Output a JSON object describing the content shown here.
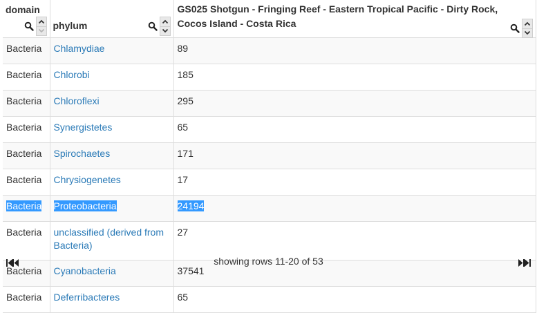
{
  "table": {
    "columns": [
      {
        "label": "domain"
      },
      {
        "label": "phylum"
      },
      {
        "label": "GS025 Shotgun - Fringing Reef - Eastern Tropical Pacific - Dirty Rock, Cocos Island - Costa Rica"
      }
    ],
    "rows": [
      {
        "domain": "Bacteria",
        "phylum": "Chlamydiae",
        "count": "89"
      },
      {
        "domain": "Bacteria",
        "phylum": "Chlorobi",
        "count": "185"
      },
      {
        "domain": "Bacteria",
        "phylum": "Chloroflexi",
        "count": "295"
      },
      {
        "domain": "Bacteria",
        "phylum": "Synergistetes",
        "count": "65"
      },
      {
        "domain": "Bacteria",
        "phylum": "Spirochaetes",
        "count": "171"
      },
      {
        "domain": "Bacteria",
        "phylum": "Chrysiogenetes",
        "count": "17"
      },
      {
        "domain": "Bacteria",
        "phylum": "Proteobacteria",
        "count": "24194"
      },
      {
        "domain": "Bacteria",
        "phylum": "unclassified (derived from Bacteria)",
        "count": "27"
      },
      {
        "domain": "Bacteria",
        "phylum": "Cyanobacteria",
        "count": "37541"
      },
      {
        "domain": "Bacteria",
        "phylum": "Deferribacteres",
        "count": "65"
      }
    ],
    "selected_row": 6
  },
  "footer": {
    "status": "showing rows 11-20 of 53"
  },
  "colors": {
    "link": "#2a7ab7",
    "selection": "#3399ff",
    "border": "#dddddd",
    "stripe": "#f9f9f9"
  },
  "icons": [
    "search-icon",
    "sort-up-icon",
    "sort-down-icon",
    "first-page-icon",
    "prev-page-icon",
    "next-page-icon",
    "last-page-icon"
  ]
}
